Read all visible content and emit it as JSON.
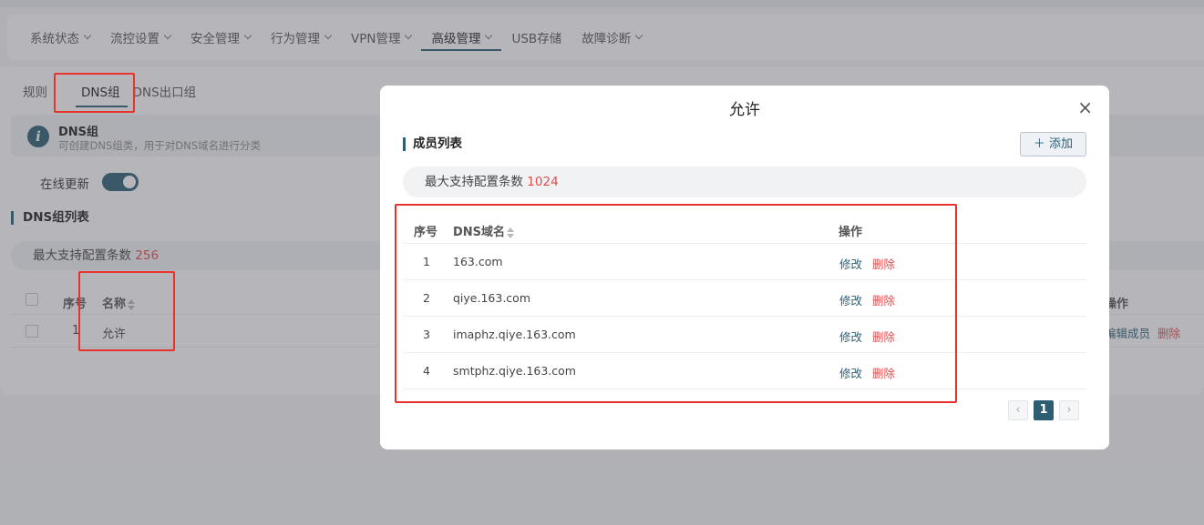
{
  "nav": {
    "items": [
      {
        "label": "系统状态"
      },
      {
        "label": "流控设置"
      },
      {
        "label": "安全管理"
      },
      {
        "label": "行为管理"
      },
      {
        "label": "VPN管理"
      },
      {
        "label": "高级管理"
      },
      {
        "label": "USB存储"
      },
      {
        "label": "故障诊断"
      }
    ]
  },
  "subtabs": {
    "rules": "规则",
    "dns_group": "DNS组",
    "dns_exit_group": "DNS出口组"
  },
  "info": {
    "title": "DNS组",
    "desc": "可创建DNS组类，用于对DNS域名进行分类"
  },
  "online_update": {
    "label": "在线更新",
    "enabled": true
  },
  "group_list": {
    "title": "DNS组列表",
    "max_label": "最大支持配置条数",
    "max_value": "256",
    "columns": {
      "no": "序号",
      "name": "名称",
      "op": "操作"
    },
    "rows": [
      {
        "no": "1",
        "name": "允许",
        "edit": "编辑成员",
        "delete": "删除"
      }
    ]
  },
  "modal": {
    "title": "允许",
    "close": "×",
    "section": "成员列表",
    "add_button": "＋ 添加",
    "max_label": "最大支持配置条数",
    "max_value": "1024",
    "columns": {
      "no": "序号",
      "domain": "DNS域名",
      "op": "操作"
    },
    "rows": [
      {
        "no": "1",
        "domain": "163.com",
        "edit": "修改",
        "delete": "删除"
      },
      {
        "no": "2",
        "domain": "qiye.163.com",
        "edit": "修改",
        "delete": "删除"
      },
      {
        "no": "3",
        "domain": "imaphz.qiye.163.com",
        "edit": "修改",
        "delete": "删除"
      },
      {
        "no": "4",
        "domain": "smtphz.qiye.163.com",
        "edit": "修改",
        "delete": "删除"
      }
    ],
    "pager": {
      "prev": "‹",
      "page": "1",
      "next": "›"
    }
  },
  "colors": {
    "accent": "#2b5d73",
    "danger": "#e24b4b",
    "annotation": "#e8332d"
  }
}
